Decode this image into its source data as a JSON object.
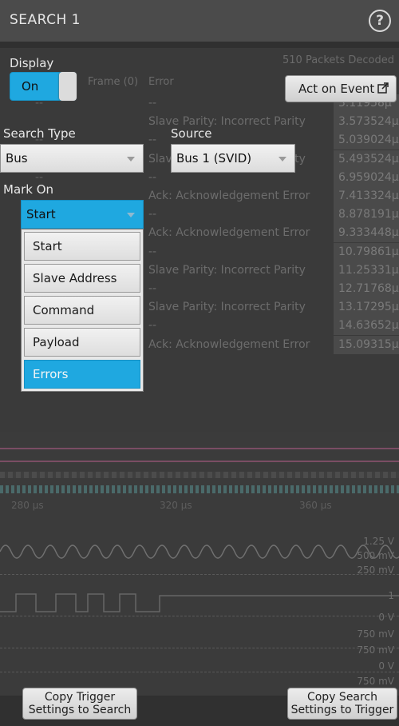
{
  "dialog": {
    "title": "SEARCH 1",
    "help_icon": "help-icon",
    "display_label": "Display",
    "display_toggle": "On",
    "act_on_event_label": "Act on Event",
    "search_type_label": "Search Type",
    "search_type_value": "Bus",
    "source_label": "Source",
    "source_value": "Bus 1 (SVID)",
    "mark_on_label": "Mark On",
    "mark_on_value": "Start",
    "mark_on_options": [
      "Start",
      "Slave Address",
      "Command",
      "Payload",
      "Errors"
    ],
    "mark_on_selected": "Errors",
    "copy_trigger_to_search_line1": "Copy Trigger",
    "copy_trigger_to_search_line2": "Settings to Search",
    "copy_search_to_trigger_line1": "Copy Search",
    "copy_search_to_trigger_line2": "Settings to Trigger"
  },
  "background": {
    "status_text": "510 Packets Decoded",
    "col_frame": "Frame (0)",
    "col_error": "Error",
    "rows": [
      {
        "error": "--",
        "time": "3.11958µ"
      },
      {
        "error": "Slave Parity: Incorrect Parity",
        "time": "3.573524µ"
      },
      {
        "error": "--",
        "time": "5.039024µ"
      },
      {
        "error": "Slave Parity: Incorrect Parity",
        "time": "5.493524µ"
      },
      {
        "error": "--",
        "time": "6.959024µ"
      },
      {
        "error": "Ack: Acknowledgement Error",
        "time": "7.413324µ"
      },
      {
        "error": "--",
        "time": "8.878191µ"
      },
      {
        "error": "Ack: Acknowledgement Error",
        "time": "9.333448µ"
      },
      {
        "error": "--",
        "time": "10.79861µ"
      },
      {
        "error": "Slave Parity: Incorrect Parity",
        "time": "11.25331µ"
      },
      {
        "error": "--",
        "time": "12.71768µ"
      },
      {
        "error": "Slave Parity: Incorrect Parity",
        "time": "13.17295µ"
      },
      {
        "error": "--",
        "time": "14.63652µ"
      },
      {
        "error": "Ack: Acknowledgement Error",
        "time": "15.09315µ"
      }
    ],
    "axis_labels": [
      "280 µs",
      "320 µs",
      "360 µs"
    ],
    "scale_labels": [
      "1.25 V",
      "500 mV",
      "250 mV",
      "1",
      "0 V",
      "750 mV",
      "750 mV",
      "0 V",
      "750 mV"
    ]
  },
  "colors": {
    "accent": "#1fa8e0",
    "panel": "#303030",
    "titlebar": "#4b4b4b"
  }
}
